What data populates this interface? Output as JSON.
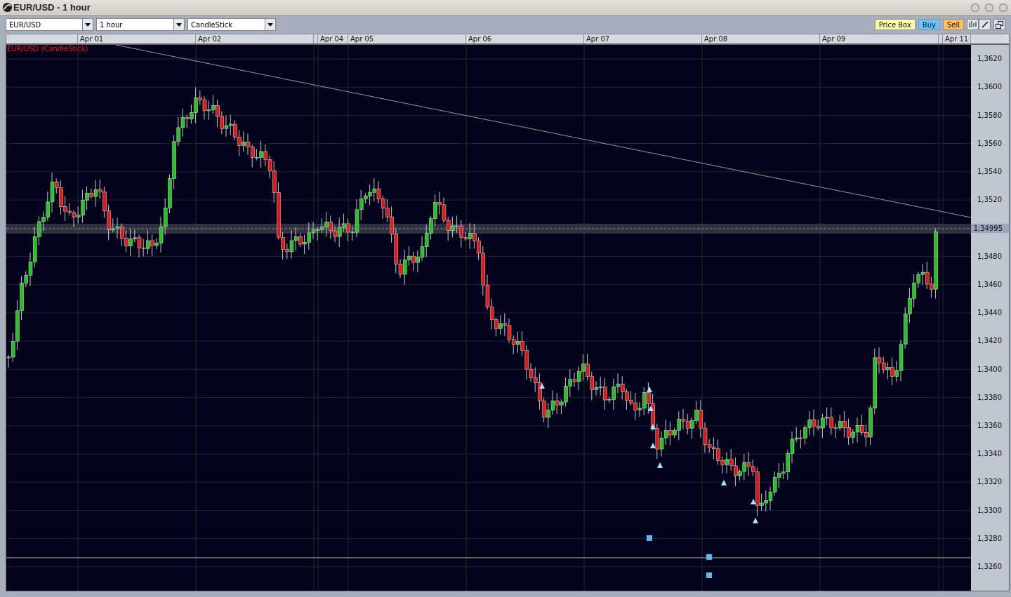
{
  "window": {
    "title": "EUR/USD - 1 hour"
  },
  "toolbar": {
    "selects": [
      {
        "value": "EUR/USD"
      },
      {
        "value": "1 hour"
      },
      {
        "value": "CandleStick"
      }
    ],
    "buttons": [
      {
        "kind": "price_box",
        "label": "Price Box"
      },
      {
        "kind": "buy",
        "label": "Buy"
      },
      {
        "kind": "sell",
        "label": "Sell"
      }
    ]
  },
  "date_headers": [
    "Apr 01",
    "Apr 02",
    "Apr 04",
    "Apr 05",
    "Apr 06",
    "Apr 07",
    "Apr 08",
    "Apr 09",
    "Apr 11"
  ],
  "chart": {
    "legend": "EUR/USD (CandleStick)",
    "current_price": "1,34995",
    "y_axis_labels": [
      "1,3620",
      "1,3600",
      "1,3580",
      "1,3560",
      "1,3540",
      "1,3520",
      "1,3480",
      "1,3460",
      "1,3440",
      "1,3420",
      "1,3400",
      "1,3380",
      "1,3360",
      "1,3340",
      "1,3320",
      "1,3300",
      "1,3280",
      "1,3260"
    ]
  }
}
